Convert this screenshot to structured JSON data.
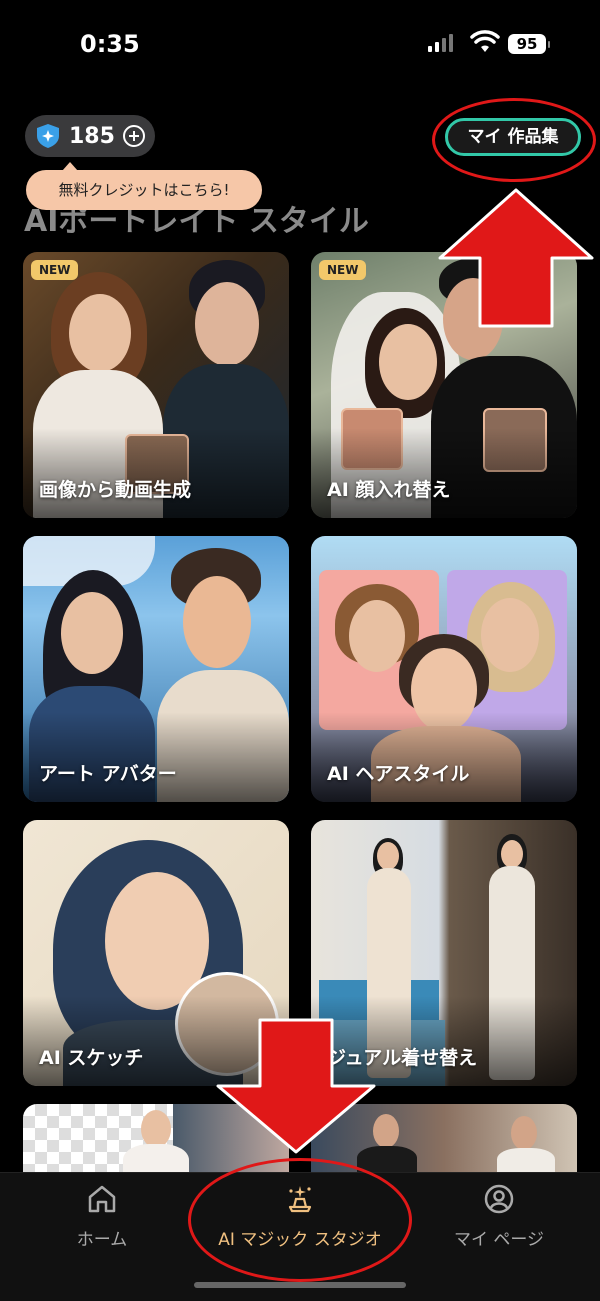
{
  "status_bar": {
    "time": "0:35",
    "battery": "95"
  },
  "header": {
    "credits": "185",
    "works_button": "マイ 作品集",
    "tooltip": "無料クレジットはこちら!"
  },
  "section": {
    "title": "AIポートレイト スタイル"
  },
  "cards": [
    {
      "label": "画像から動画生成",
      "badge": "NEW"
    },
    {
      "label": "AI 顔入れ替え",
      "badge": "NEW"
    },
    {
      "label": "アート アバター"
    },
    {
      "label": "AI ヘアスタイル"
    },
    {
      "label": "AI スケッチ"
    },
    {
      "label": "ジュアル着せ替え"
    }
  ],
  "tabbar": {
    "tabs": [
      {
        "label": "ホーム",
        "icon": "home-icon"
      },
      {
        "label": "AI マジック スタジオ",
        "icon": "magic-hat-icon",
        "active": true
      },
      {
        "label": "マイ ページ",
        "icon": "profile-icon"
      }
    ]
  },
  "colors": {
    "accent_teal": "#32c8a8",
    "annotation_red": "#e01818",
    "active_tab": "#f0c080"
  }
}
